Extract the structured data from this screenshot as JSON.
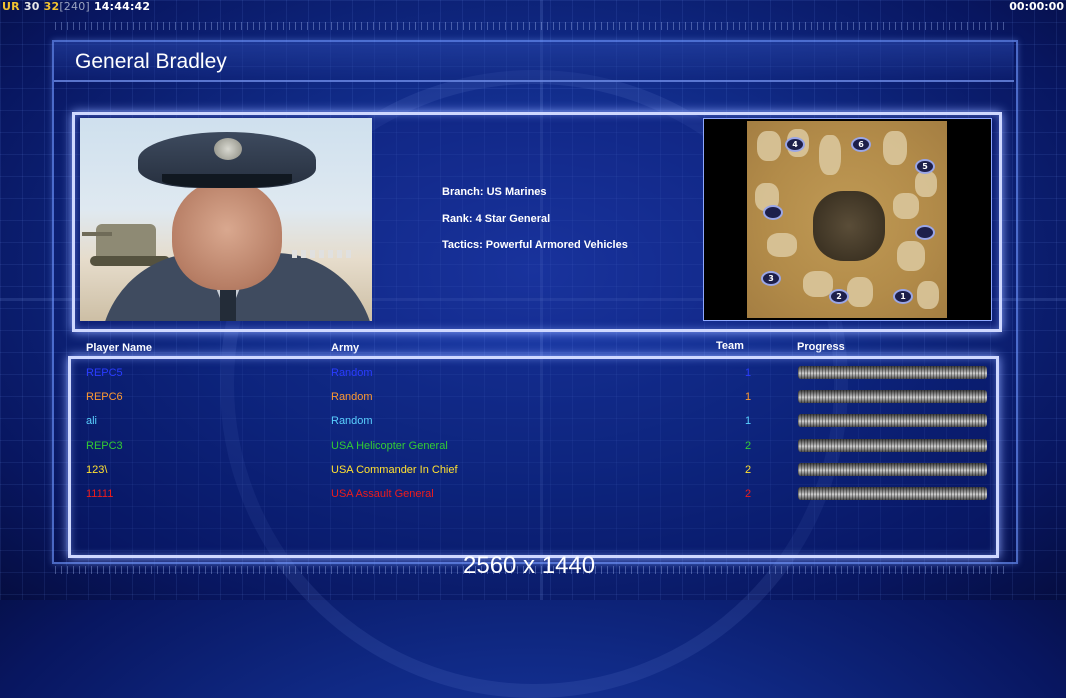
{
  "hud": {
    "ur_label": "UR",
    "ur_value": "30",
    "ur_value2": "32",
    "ur_bracket": "[240]",
    "clock": "14:44:42",
    "timer": "00:00:00"
  },
  "screen": {
    "title": "General Bradley",
    "resolution": "2560 x 1440"
  },
  "general": {
    "branch": "Branch: US Marines",
    "rank": "Rank: 4 Star General",
    "tactics": "Tactics: Powerful Armored Vehicles"
  },
  "minimap": {
    "start_positions": [
      "4",
      "6",
      "5",
      "3",
      "2",
      "1"
    ]
  },
  "table": {
    "headers": {
      "player_name": "Player Name",
      "army": "Army",
      "team": "Team",
      "progress": "Progress"
    },
    "rows": [
      {
        "name": "REPC5",
        "army": "Random",
        "team": "1",
        "color": "#2a3cff",
        "progress": 1.0
      },
      {
        "name": "REPC6",
        "army": "Random",
        "team": "1",
        "color": "#ff9a30",
        "progress": 1.0
      },
      {
        "name": "ali",
        "army": "Random",
        "team": "1",
        "color": "#5ad0ff",
        "progress": 1.0
      },
      {
        "name": "REPC3",
        "army": "USA Helicopter General",
        "team": "2",
        "color": "#33cc33",
        "progress": 1.0
      },
      {
        "name": "123\\",
        "army": "USA Commander In Chief",
        "team": "2",
        "color": "#ffe030",
        "progress": 1.0
      },
      {
        "name": "11111",
        "army": "USA Assault General",
        "team": "2",
        "color": "#ee1c1c",
        "progress": 1.0
      }
    ]
  }
}
